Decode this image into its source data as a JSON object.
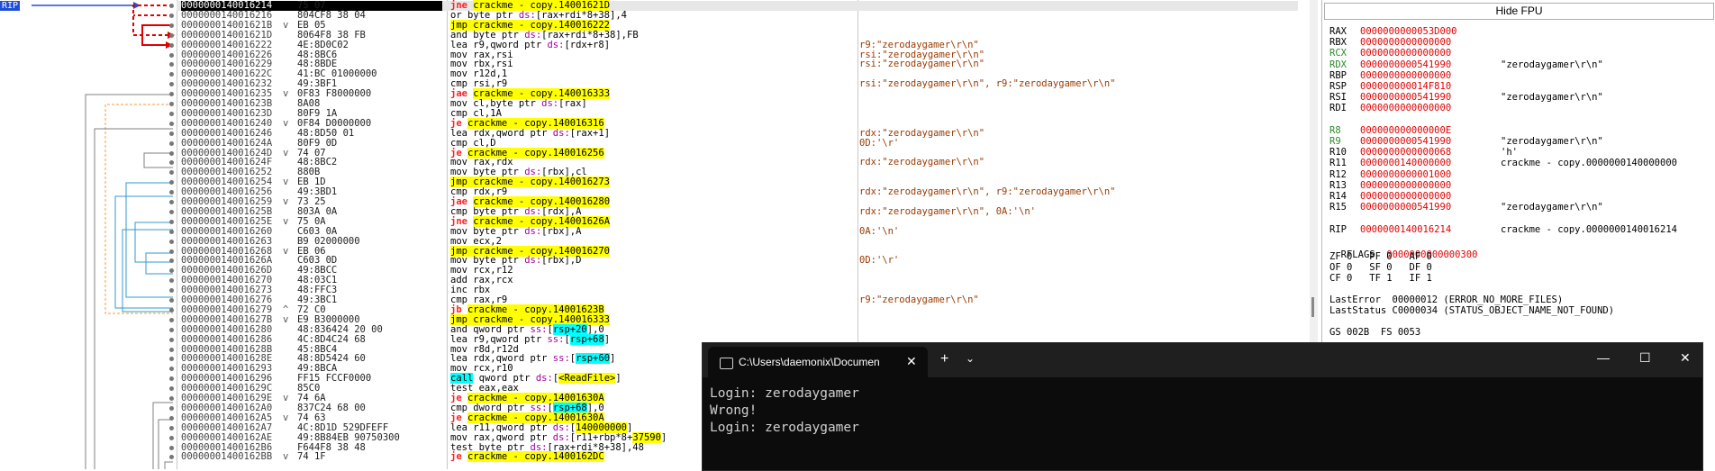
{
  "disassembly": {
    "rip_label": "RIP",
    "rows": [
      {
        "addr": "0000000140016214",
        "arrow": "",
        "bytes": "75 07",
        "instr": [
          {
            "t": "jne",
            "c": "mn-j"
          },
          {
            "t": " "
          },
          {
            "t": "crackme - copy.14001621D",
            "c": "hl-jmp"
          }
        ],
        "cmt": "",
        "cur": true
      },
      {
        "addr": "0000000140016216",
        "arrow": "",
        "bytes": "804CF8 38 04",
        "instr": [
          {
            "t": "or byte ptr "
          },
          {
            "t": "ds:",
            "c": "ptr"
          },
          {
            "t": "[rax+rdi*8+38]"
          },
          {
            "t": ",4"
          }
        ],
        "cmt": ""
      },
      {
        "addr": "000000014001621B",
        "arrow": "v",
        "bytes": "EB 05",
        "instr": [
          {
            "t": "jmp crackme - copy.140016222",
            "c": "hl-jmp"
          }
        ],
        "cmt": ""
      },
      {
        "addr": "000000014001621D",
        "arrow": "",
        "bytes": "8064F8 38 FB",
        "instr": [
          {
            "t": "and byte ptr "
          },
          {
            "t": "ds:",
            "c": "ptr"
          },
          {
            "t": "[rax+rdi*8+38]"
          },
          {
            "t": ",FB"
          }
        ],
        "cmt": ""
      },
      {
        "addr": "0000000140016222",
        "arrow": "",
        "bytes": "4E:8D0C02",
        "instr": [
          {
            "t": "lea r9,qword ptr "
          },
          {
            "t": "ds:",
            "c": "ptr"
          },
          {
            "t": "[rdx+r8]"
          }
        ],
        "cmt": "r9:\"zerodaygamer\\r\\n\""
      },
      {
        "addr": "0000000140016226",
        "arrow": "",
        "bytes": "48:8BC6",
        "instr": [
          {
            "t": "mov rax,rsi"
          }
        ],
        "cmt": "rsi:\"zerodaygamer\\r\\n\""
      },
      {
        "addr": "0000000140016229",
        "arrow": "",
        "bytes": "48:8BDE",
        "instr": [
          {
            "t": "mov rbx,rsi"
          }
        ],
        "cmt": "rsi:\"zerodaygamer\\r\\n\""
      },
      {
        "addr": "000000014001622C",
        "arrow": "",
        "bytes": "41:BC 01000000",
        "instr": [
          {
            "t": "mov r12d,1"
          }
        ],
        "cmt": ""
      },
      {
        "addr": "0000000140016232",
        "arrow": "",
        "bytes": "49:3BF1",
        "instr": [
          {
            "t": "cmp rsi,r9"
          }
        ],
        "cmt": "rsi:\"zerodaygamer\\r\\n\", r9:\"zerodaygamer\\r\\n\""
      },
      {
        "addr": "0000000140016235",
        "arrow": "v",
        "bytes": "0F83 F8000000",
        "instr": [
          {
            "t": "jae",
            "c": "mn-j"
          },
          {
            "t": " "
          },
          {
            "t": "crackme - copy.140016333",
            "c": "hl-jmp"
          }
        ],
        "cmt": ""
      },
      {
        "addr": "000000014001623B",
        "arrow": "",
        "bytes": "8A08",
        "instr": [
          {
            "t": "mov cl,byte ptr "
          },
          {
            "t": "ds:",
            "c": "ptr"
          },
          {
            "t": "[rax]"
          }
        ],
        "cmt": ""
      },
      {
        "addr": "000000014001623D",
        "arrow": "",
        "bytes": "80F9 1A",
        "instr": [
          {
            "t": "cmp cl,1A"
          }
        ],
        "cmt": ""
      },
      {
        "addr": "0000000140016240",
        "arrow": "v",
        "bytes": "0F84 D0000000",
        "instr": [
          {
            "t": "je",
            "c": "mn-j"
          },
          {
            "t": " "
          },
          {
            "t": "crackme - copy.140016316",
            "c": "hl-jmp"
          }
        ],
        "cmt": ""
      },
      {
        "addr": "0000000140016246",
        "arrow": "",
        "bytes": "48:8D50 01",
        "instr": [
          {
            "t": "lea rdx,qword ptr "
          },
          {
            "t": "ds:",
            "c": "ptr"
          },
          {
            "t": "[rax+1]"
          }
        ],
        "cmt": "rdx:\"zerodaygamer\\r\\n\""
      },
      {
        "addr": "000000014001624A",
        "arrow": "",
        "bytes": "80F9 0D",
        "instr": [
          {
            "t": "cmp cl,D"
          }
        ],
        "cmt": "0D:'\\r'"
      },
      {
        "addr": "000000014001624D",
        "arrow": "v",
        "bytes": "74 07",
        "instr": [
          {
            "t": "je",
            "c": "mn-j"
          },
          {
            "t": " "
          },
          {
            "t": "crackme - copy.140016256",
            "c": "hl-jmp"
          }
        ],
        "cmt": ""
      },
      {
        "addr": "000000014001624F",
        "arrow": "",
        "bytes": "48:8BC2",
        "instr": [
          {
            "t": "mov rax,rdx"
          }
        ],
        "cmt": "rdx:\"zerodaygamer\\r\\n\""
      },
      {
        "addr": "0000000140016252",
        "arrow": "",
        "bytes": "880B",
        "instr": [
          {
            "t": "mov byte ptr "
          },
          {
            "t": "ds:",
            "c": "ptr"
          },
          {
            "t": "[rbx],cl"
          }
        ],
        "cmt": ""
      },
      {
        "addr": "0000000140016254",
        "arrow": "v",
        "bytes": "EB 1D",
        "instr": [
          {
            "t": "jmp crackme - copy.140016273",
            "c": "hl-jmp"
          }
        ],
        "cmt": ""
      },
      {
        "addr": "0000000140016256",
        "arrow": "",
        "bytes": "49:3BD1",
        "instr": [
          {
            "t": "cmp rdx,r9"
          }
        ],
        "cmt": "rdx:\"zerodaygamer\\r\\n\", r9:\"zerodaygamer\\r\\n\""
      },
      {
        "addr": "0000000140016259",
        "arrow": "v",
        "bytes": "73 25",
        "instr": [
          {
            "t": "jae",
            "c": "mn-j"
          },
          {
            "t": " "
          },
          {
            "t": "crackme - copy.140016280",
            "c": "hl-jmp"
          }
        ],
        "cmt": ""
      },
      {
        "addr": "000000014001625B",
        "arrow": "",
        "bytes": "803A 0A",
        "instr": [
          {
            "t": "cmp byte ptr "
          },
          {
            "t": "ds:",
            "c": "ptr"
          },
          {
            "t": "[rdx],A"
          }
        ],
        "cmt": "rdx:\"zerodaygamer\\r\\n\", 0A:'\\n'"
      },
      {
        "addr": "000000014001625E",
        "arrow": "v",
        "bytes": "75 0A",
        "instr": [
          {
            "t": "jne",
            "c": "mn-j"
          },
          {
            "t": " "
          },
          {
            "t": "crackme - copy.14001626A",
            "c": "hl-jmp"
          }
        ],
        "cmt": ""
      },
      {
        "addr": "0000000140016260",
        "arrow": "",
        "bytes": "C603 0A",
        "instr": [
          {
            "t": "mov byte ptr "
          },
          {
            "t": "ds:",
            "c": "ptr"
          },
          {
            "t": "[rbx],A"
          }
        ],
        "cmt": "0A:'\\n'"
      },
      {
        "addr": "0000000140016263",
        "arrow": "",
        "bytes": "B9 02000000",
        "instr": [
          {
            "t": "mov ecx,2"
          }
        ],
        "cmt": ""
      },
      {
        "addr": "0000000140016268",
        "arrow": "v",
        "bytes": "EB 06",
        "instr": [
          {
            "t": "jmp crackme - copy.140016270",
            "c": "hl-jmp"
          }
        ],
        "cmt": ""
      },
      {
        "addr": "000000014001626A",
        "arrow": "",
        "bytes": "C603 0D",
        "instr": [
          {
            "t": "mov byte ptr "
          },
          {
            "t": "ds:",
            "c": "ptr"
          },
          {
            "t": "[rbx],D"
          }
        ],
        "cmt": "0D:'\\r'"
      },
      {
        "addr": "000000014001626D",
        "arrow": "",
        "bytes": "49:8BCC",
        "instr": [
          {
            "t": "mov rcx,r12"
          }
        ],
        "cmt": ""
      },
      {
        "addr": "0000000140016270",
        "arrow": "",
        "bytes": "48:03C1",
        "instr": [
          {
            "t": "add rax,rcx"
          }
        ],
        "cmt": ""
      },
      {
        "addr": "0000000140016273",
        "arrow": "",
        "bytes": "48:FFC3",
        "instr": [
          {
            "t": "inc rbx"
          }
        ],
        "cmt": ""
      },
      {
        "addr": "0000000140016276",
        "arrow": "",
        "bytes": "49:3BC1",
        "instr": [
          {
            "t": "cmp rax,r9"
          }
        ],
        "cmt": "r9:\"zerodaygamer\\r\\n\""
      },
      {
        "addr": "0000000140016279",
        "arrow": "^",
        "bytes": "72 C0",
        "instr": [
          {
            "t": "jb",
            "c": "mn-j"
          },
          {
            "t": " "
          },
          {
            "t": "crackme - copy.14001623B",
            "c": "hl-jmp"
          }
        ],
        "cmt": ""
      },
      {
        "addr": "000000014001627B",
        "arrow": "v",
        "bytes": "E9 B3000000",
        "instr": [
          {
            "t": "jmp crackme - copy.140016333",
            "c": "hl-jmp"
          }
        ],
        "cmt": ""
      },
      {
        "addr": "0000000140016280",
        "arrow": "",
        "bytes": "48:836424 20 00",
        "instr": [
          {
            "t": "and qword ptr "
          },
          {
            "t": "ss:",
            "c": "ptr"
          },
          {
            "t": "["
          },
          {
            "t": "rsp+20",
            "c": "hl-call"
          },
          {
            "t": "],0"
          }
        ],
        "cmt": ""
      },
      {
        "addr": "0000000140016286",
        "arrow": "",
        "bytes": "4C:8D4C24 68",
        "instr": [
          {
            "t": "lea r9,qword ptr "
          },
          {
            "t": "ss:",
            "c": "ptr"
          },
          {
            "t": "["
          },
          {
            "t": "rsp+68",
            "c": "hl-call"
          },
          {
            "t": "]"
          }
        ],
        "cmt": ""
      },
      {
        "addr": "000000014001628B",
        "arrow": "",
        "bytes": "45:8BC4",
        "instr": [
          {
            "t": "mov r8d,r12d"
          }
        ],
        "cmt": ""
      },
      {
        "addr": "000000014001628E",
        "arrow": "",
        "bytes": "48:8D5424 60",
        "instr": [
          {
            "t": "lea rdx,qword ptr "
          },
          {
            "t": "ss:",
            "c": "ptr"
          },
          {
            "t": "["
          },
          {
            "t": "rsp+60",
            "c": "hl-call"
          },
          {
            "t": "]"
          }
        ],
        "cmt": ""
      },
      {
        "addr": "0000000140016293",
        "arrow": "",
        "bytes": "49:8BCA",
        "instr": [
          {
            "t": "mov rcx,r10"
          }
        ],
        "cmt": ""
      },
      {
        "addr": "0000000140016296",
        "arrow": "",
        "bytes": "FF15 FCCF0000",
        "instr": [
          {
            "t": "call",
            "c": "hl-call"
          },
          {
            "t": " qword ptr "
          },
          {
            "t": "ds:",
            "c": "ptr"
          },
          {
            "t": "["
          },
          {
            "t": "<ReadFile>",
            "c": "hl-jmp"
          },
          {
            "t": "]"
          }
        ],
        "cmt": ""
      },
      {
        "addr": "000000014001629C",
        "arrow": "",
        "bytes": "85C0",
        "instr": [
          {
            "t": "test eax,eax"
          }
        ],
        "cmt": ""
      },
      {
        "addr": "000000014001629E",
        "arrow": "v",
        "bytes": "74 6A",
        "instr": [
          {
            "t": "je",
            "c": "mn-j"
          },
          {
            "t": " "
          },
          {
            "t": "crackme - copy.14001630A",
            "c": "hl-jmp"
          }
        ],
        "cmt": ""
      },
      {
        "addr": "00000001400162A0",
        "arrow": "",
        "bytes": "837C24 68 00",
        "instr": [
          {
            "t": "cmp dword ptr "
          },
          {
            "t": "ss:",
            "c": "ptr"
          },
          {
            "t": "["
          },
          {
            "t": "rsp+68",
            "c": "hl-call"
          },
          {
            "t": "],0"
          }
        ],
        "cmt": ""
      },
      {
        "addr": "00000001400162A5",
        "arrow": "v",
        "bytes": "74 63",
        "instr": [
          {
            "t": "je",
            "c": "mn-j"
          },
          {
            "t": " "
          },
          {
            "t": "crackme - copy.14001630A",
            "c": "hl-jmp"
          }
        ],
        "cmt": ""
      },
      {
        "addr": "00000001400162A7",
        "arrow": "",
        "bytes": "4C:8D1D 529DFEFF",
        "instr": [
          {
            "t": "lea r11,qword ptr "
          },
          {
            "t": "ds:",
            "c": "ptr"
          },
          {
            "t": "["
          },
          {
            "t": "140000000",
            "c": "hl-jmp"
          },
          {
            "t": "]"
          }
        ],
        "cmt": ""
      },
      {
        "addr": "00000001400162AE",
        "arrow": "",
        "bytes": "49:8B84EB 90750300",
        "instr": [
          {
            "t": "mov rax,qword ptr "
          },
          {
            "t": "ds:",
            "c": "ptr"
          },
          {
            "t": "[r11+rbp*8+"
          },
          {
            "t": "37590",
            "c": "hl-jmp"
          },
          {
            "t": "]"
          }
        ],
        "cmt": ""
      },
      {
        "addr": "00000001400162B6",
        "arrow": "",
        "bytes": "F644F8 38 48",
        "instr": [
          {
            "t": "test byte ptr "
          },
          {
            "t": "ds:",
            "c": "ptr"
          },
          {
            "t": "[rax+rdi*8+38],48"
          }
        ],
        "cmt": ""
      },
      {
        "addr": "00000001400162BB",
        "arrow": "v",
        "bytes": "74 1F",
        "instr": [
          {
            "t": "je",
            "c": "mn-j"
          },
          {
            "t": " "
          },
          {
            "t": "crackme - copy.1400162DC",
            "c": "hl-jmp"
          }
        ],
        "cmt": ""
      }
    ]
  },
  "registers": {
    "hide_fpu_label": "Hide FPU",
    "lines": [
      {
        "name": "RAX",
        "value": "0000000000053D000",
        "comment": "",
        "color": "#000"
      },
      {
        "name": "RBX",
        "value": "0000000000000000",
        "comment": "",
        "color": "#000"
      },
      {
        "name": "RCX",
        "value": "0000000000000000",
        "comment": "",
        "color": "#2a8a2a"
      },
      {
        "name": "RDX",
        "value": "0000000000541990",
        "comment": "\"zerodaygamer\\r\\n\"",
        "color": "#2a8a2a"
      },
      {
        "name": "RBP",
        "value": "0000000000000000",
        "comment": "",
        "color": "#000"
      },
      {
        "name": "RSP",
        "value": "000000000014F810",
        "comment": "",
        "color": "#000"
      },
      {
        "name": "RSI",
        "value": "0000000000541990",
        "comment": "\"zerodaygamer\\r\\n\"",
        "color": "#000"
      },
      {
        "name": "RDI",
        "value": "0000000000000000",
        "comment": "",
        "color": "#000"
      },
      {
        "name": "",
        "value": "",
        "comment": "",
        "color": "#000"
      },
      {
        "name": "R8",
        "value": "000000000000000E",
        "comment": "",
        "color": "#2a8a2a"
      },
      {
        "name": "R9",
        "value": "0000000000541990",
        "comment": "\"zerodaygamer\\r\\n\"",
        "color": "#2a8a2a"
      },
      {
        "name": "R10",
        "value": "0000000000000068",
        "comment": "'h'",
        "color": "#000"
      },
      {
        "name": "R11",
        "value": "0000000140000000",
        "comment": "crackme - copy.0000000140000000",
        "color": "#000"
      },
      {
        "name": "R12",
        "value": "0000000000001000",
        "comment": "",
        "color": "#000"
      },
      {
        "name": "R13",
        "value": "0000000000000000",
        "comment": "",
        "color": "#000"
      },
      {
        "name": "R14",
        "value": "0000000000000000",
        "comment": "",
        "color": "#000"
      },
      {
        "name": "R15",
        "value": "0000000000541990",
        "comment": "\"zerodaygamer\\r\\n\"",
        "color": "#000"
      },
      {
        "name": "",
        "value": "",
        "comment": "",
        "color": "#000"
      },
      {
        "name": "RIP",
        "value": "0000000140016214",
        "comment": "crackme - copy.0000000140016214",
        "color": "#000"
      }
    ],
    "rflags_label": "RFLAGS",
    "rflags_value": "0000000000000300",
    "flags_row1": "ZF 0   PF 0   AF 0",
    "flags_row2": "OF 0   SF 0   DF 0",
    "flags_row3": "CF 0   TF 1   IF 1",
    "last_error": "LastError  00000012 (ERROR_NO_MORE_FILES)",
    "last_status": "LastStatus C0000034 (STATUS_OBJECT_NAME_NOT_FOUND)",
    "segments": "GS 002B  FS 0053"
  },
  "terminal": {
    "tab_title": "C:\\Users\\daemonix\\Documen",
    "tab_close": "✕",
    "new_tab": "+",
    "dropdown": "⌄",
    "minimize": "—",
    "maximize": "☐",
    "close": "✕",
    "lines": [
      "Login: zerodaygamer",
      "Wrong!",
      "Login: zerodaygamer"
    ]
  }
}
